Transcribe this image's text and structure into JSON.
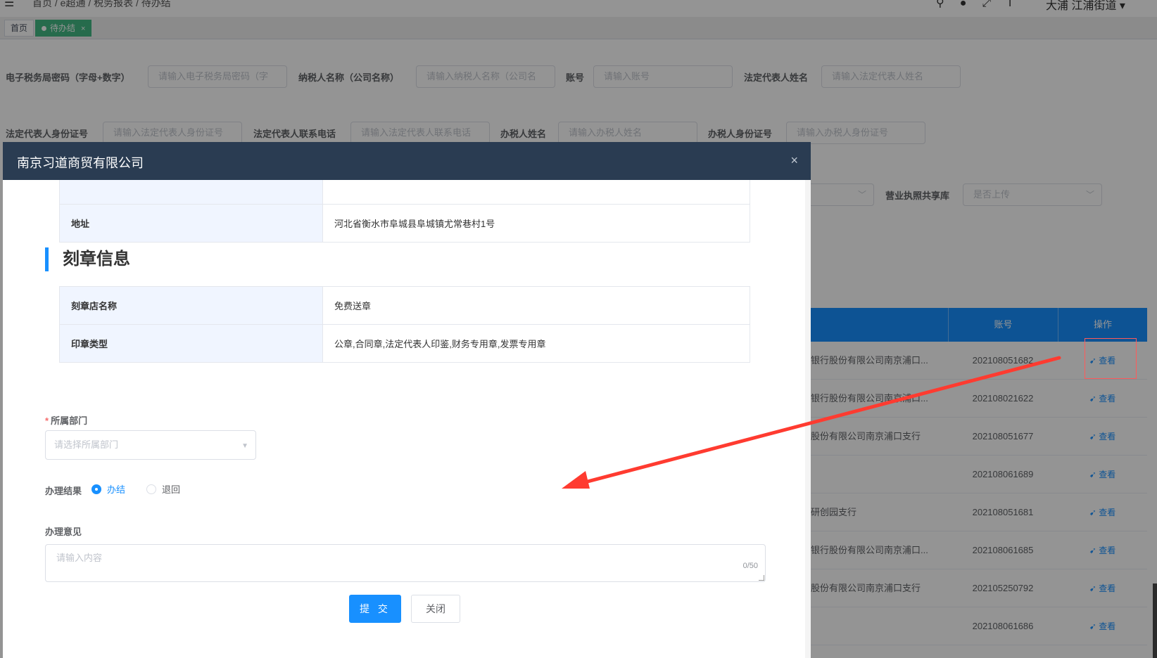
{
  "topbar": {
    "menu_icon": "hamburger-icon",
    "breadcrumb": "首页 / e超通 / 税务报表 / 待办结",
    "icons": [
      "search-icon",
      "question-icon",
      "fullscreen-icon",
      "font-size-icon"
    ],
    "user": "大浦  江浦街道"
  },
  "tags": {
    "home": "首页",
    "active": "待办结",
    "close": "×"
  },
  "filters": {
    "tax_pwd_label": "电子税务局密码（字母+数字）",
    "tax_pwd_placeholder": "请输入电子税务局密码（字",
    "taxpayer_name_label": "纳税人名称（公司名称）",
    "taxpayer_name_placeholder": "请输入纳税人名称（公司名",
    "account_label": "账号",
    "account_placeholder": "请输入账号",
    "legal_name_label": "法定代表人姓名",
    "legal_name_placeholder": "请输入法定代表人姓名",
    "legal_id_label": "法定代表人身份证号",
    "legal_id_placeholder": "请输入法定代表人身份证号",
    "legal_phone_label": "法定代表人联系电话",
    "legal_phone_placeholder": "请输入法定代表人联系电话",
    "handler_name_label": "办税人姓名",
    "handler_name_placeholder": "请输入办税人姓名",
    "handler_id_label": "办税人身份证号",
    "handler_id_placeholder": "请输入办税人身份证号",
    "license_label": "营业执照共享库",
    "license_placeholder": "是否上传"
  },
  "table": {
    "col_account": "账号",
    "col_action": "操作",
    "view_label": "查看",
    "rows": [
      {
        "bank": "银行股份有限公司南京浦口...",
        "account": "202108051682"
      },
      {
        "bank": "银行股份有限公司南京浦口...",
        "account": "202108021622"
      },
      {
        "bank": "股份有限公司南京浦口支行",
        "account": "202108051677"
      },
      {
        "bank": "",
        "account": "202108061689"
      },
      {
        "bank": "研创园支行",
        "account": "202108051681"
      },
      {
        "bank": "银行股份有限公司南京浦口...",
        "account": "202108061685"
      },
      {
        "bank": "股份有限公司南京浦口支行",
        "account": "202105250792"
      },
      {
        "bank": "",
        "account": "202108061686"
      }
    ]
  },
  "dialog": {
    "title": "南京习道商贸有限公司",
    "close": "×",
    "address_label": "地址",
    "address_value": "河北省衡水市阜城县阜城镇尤常巷村1号",
    "seal_section_title": "刻章信息",
    "seal_shop_label": "刻章店名称",
    "seal_shop_value": "免费送章",
    "seal_type_label": "印章类型",
    "seal_type_value": "公章,合同章,法定代表人印鉴,财务专用章,发票专用章",
    "dept_label": "所属部门",
    "dept_placeholder": "请选择所属部门",
    "result_label": "办理结果",
    "result_options": [
      "办结",
      "退回"
    ],
    "opinion_label": "办理意见",
    "opinion_placeholder": "请输入内容",
    "opinion_count": "0/50",
    "submit_label": "提 交",
    "cancel_label": "关闭"
  },
  "colors": {
    "primary": "#1890ff",
    "header_dark": "#2a3c52",
    "tag_green": "#42b983",
    "annotation_red": "#ff3b30"
  }
}
